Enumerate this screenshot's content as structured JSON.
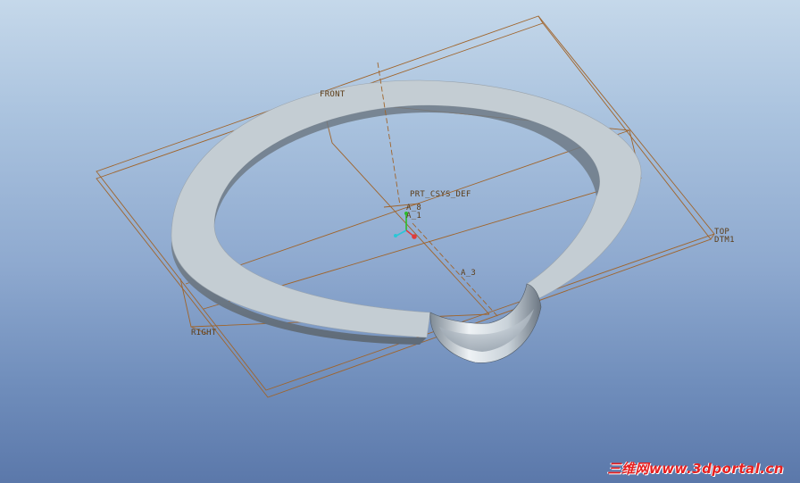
{
  "viewport": {
    "datum_labels": {
      "front": "FRONT",
      "top": "TOP",
      "dtm1": "DTM1",
      "right": "RIGHT",
      "csys": "PRT_CSYS_DEF",
      "axis_a8": "A_8",
      "axis_a3": "A_3",
      "axis_a1": "A_1"
    },
    "watermark": "三维网www.3dportal.cn"
  },
  "colors": {
    "background_top": "#c5d8ea",
    "background_bottom": "#5b78aa",
    "datum": "#a0642a",
    "datum_text": "#5c3d18",
    "model_surface": "#c4cdd3",
    "watermark": "#e62020"
  }
}
